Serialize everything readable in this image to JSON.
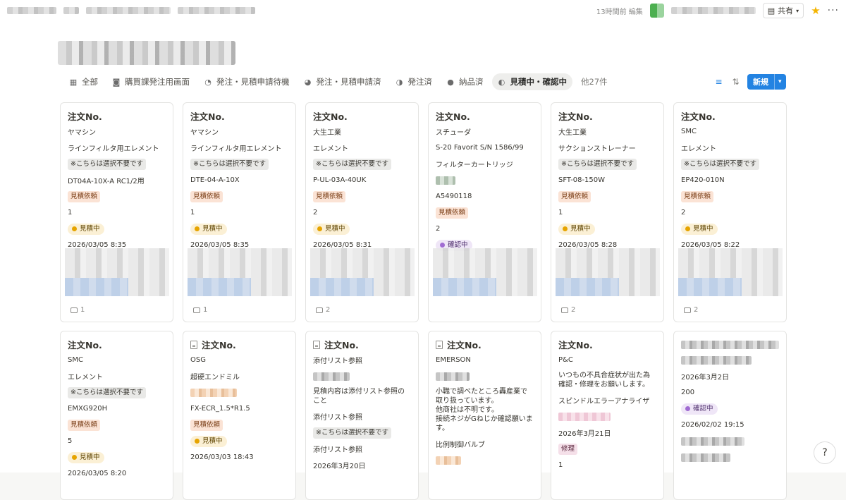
{
  "topbar": {
    "edited": "13時間前 編集",
    "share_label": "共有",
    "star_icon": "star-icon",
    "more_icon": "more-dots-icon"
  },
  "tabs": [
    {
      "icon": "table-icon",
      "glyph": "▦",
      "label": "全部"
    },
    {
      "icon": "camera-icon",
      "glyph": "◙",
      "label": "購買課発注用画面"
    },
    {
      "icon": "progress-icon",
      "glyph": "◔",
      "label": "発注・見積申請待機"
    },
    {
      "icon": "progress-icon",
      "glyph": "◕",
      "label": "発注・見積申請済"
    },
    {
      "icon": "progress-icon",
      "glyph": "◑",
      "label": "発注済"
    },
    {
      "icon": "progress-icon",
      "glyph": "●",
      "label": "納品済"
    },
    {
      "icon": "progress-icon",
      "glyph": "◐",
      "label": "見積中・確認中",
      "active": true
    }
  ],
  "more_views": "他27件",
  "new_button": "新規",
  "toolbar_icons": [
    "filter-icon",
    "sort-icon",
    "automation-icon",
    "search-icon",
    "settings-icon"
  ],
  "cards": [
    {
      "title": "注文No.",
      "maker": "ヤマシン",
      "name": "ラインフィルタ用エレメント",
      "note": "※こちらは選択不要です",
      "model": "DT04A-10X-A RC1/2用",
      "type": "見積依頼",
      "qty": "1",
      "status": "見積中",
      "date": "2026/03/05 8:35",
      "comments": "1"
    },
    {
      "title": "注文No.",
      "maker": "ヤマシン",
      "name": "ラインフィルタ用エレメント",
      "note": "※こちらは選択不要です",
      "model": "DTE-04-A-10X",
      "type": "見積依頼",
      "qty": "1",
      "status": "見積中",
      "date": "2026/03/05 8:35",
      "comments": "1"
    },
    {
      "title": "注文No.",
      "maker": "大生工業",
      "name": "エレメント",
      "note": "※こちらは選択不要です",
      "model": "P-UL-03A-40UK",
      "type": "見積依頼",
      "qty": "2",
      "status": "見積中",
      "date": "2026/03/05 8:31",
      "comments": "2"
    },
    {
      "title": "注文No.",
      "maker": "スチューダ",
      "name": "S-20 Favorit  S/N 1586/99",
      "note": "フィルターカートリッジ",
      "model": "A5490118",
      "type": "見積依頼",
      "qty": "2",
      "status": "確認中",
      "date": "",
      "comments": ""
    },
    {
      "title": "注文No.",
      "maker": "大生工業",
      "name": "サクションストレーナー",
      "note": "※こちらは選択不要です",
      "model": "SFT-08-150W",
      "type": "見積依頼",
      "qty": "1",
      "status": "見積中",
      "date": "2026/03/05 8:28",
      "comments": "2"
    },
    {
      "title": "注文No.",
      "maker": "SMC",
      "name": "エレメント",
      "note": "※こちらは選択不要です",
      "model": "EP420-010N",
      "type": "見積依頼",
      "qty": "2",
      "status": "見積中",
      "date": "2026/03/05 8:22",
      "comments": "2"
    }
  ],
  "row2": [
    {
      "title": "注文No.",
      "l1": "SMC",
      "l2": "エレメント",
      "l3": "※こちらは選択不要です",
      "l4": "EMXG920H",
      "l5": "見積依頼",
      "l6": "5",
      "l7": "見積中",
      "l8": "2026/03/05 8:20"
    },
    {
      "title": "注文No.",
      "l1": "OSG",
      "l2": "超硬エンドミル",
      "l4": "FX-ECR_1.5*R1.5",
      "l5": "見積依頼",
      "l7": "見積中",
      "l8": "2026/03/03 18:43"
    },
    {
      "title": "注文No.",
      "l1": "添付リスト参照",
      "l2": "見積内容は添付リスト参照のこと",
      "l3": "添付リスト参照",
      "l4": "※こちらは選択不要です",
      "l5": "添付リスト参照",
      "l6": "2026年3月20日"
    },
    {
      "title": "注文No.",
      "l1": "EMERSON",
      "l2": "小職で調べたところ轟産業で取り扱っています。\n他商社は不明です。\n接続ネジがGねじか確認願います。",
      "l3": "比例制御バルブ"
    },
    {
      "title": "注文No.",
      "l1": "P&C",
      "l2": "いつもの不具合症状が出た為確認・修理をお願いします。",
      "l3": "スピンドルエラーアナライザ",
      "l4": "2026年3月21日",
      "l5": "修理",
      "l6": "1"
    },
    {
      "title": "",
      "l1": "2026年3月2日",
      "l2": "200",
      "l3": "確認中",
      "l4": "2026/02/02 19:15"
    }
  ]
}
